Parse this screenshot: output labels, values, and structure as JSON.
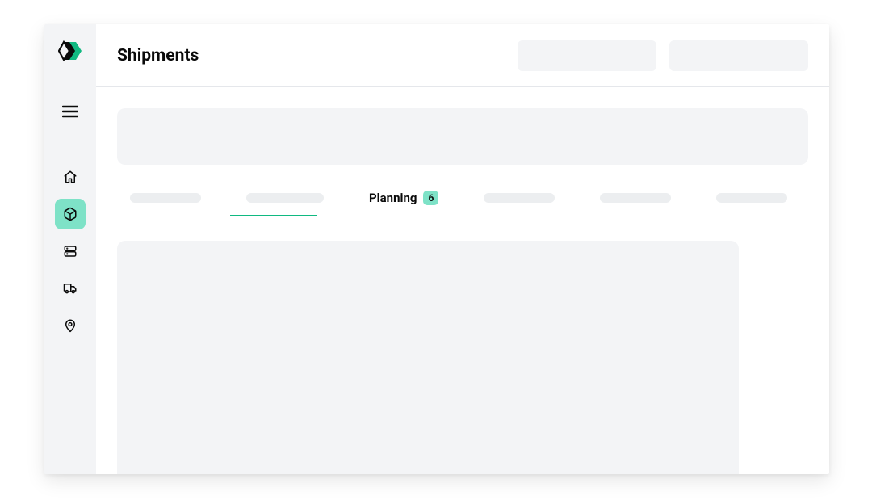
{
  "page": {
    "title": "Shipments"
  },
  "tabs": {
    "active": {
      "label": "Planning",
      "badge": "6"
    }
  },
  "sidebar": {
    "items": [
      {
        "name": "home"
      },
      {
        "name": "shipments"
      },
      {
        "name": "inventory"
      },
      {
        "name": "vehicles"
      },
      {
        "name": "locations"
      }
    ]
  }
}
